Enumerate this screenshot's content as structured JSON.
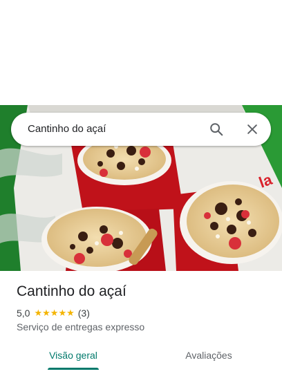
{
  "search": {
    "query": "Cantinho do açaí"
  },
  "place": {
    "name": "Cantinho do açaí",
    "rating": "5,0",
    "review_count": "(3)",
    "stars": 5,
    "category": "Serviço de entregas expresso"
  },
  "tabs": [
    {
      "label": "Visão geral",
      "selected": true
    },
    {
      "label": "Avaliações",
      "selected": false
    }
  ],
  "colors": {
    "accent": "#00796b",
    "star": "#f4b400",
    "hero_background": "#1f7f2c"
  },
  "icons": [
    "search-icon",
    "close-icon",
    "star-icon"
  ]
}
